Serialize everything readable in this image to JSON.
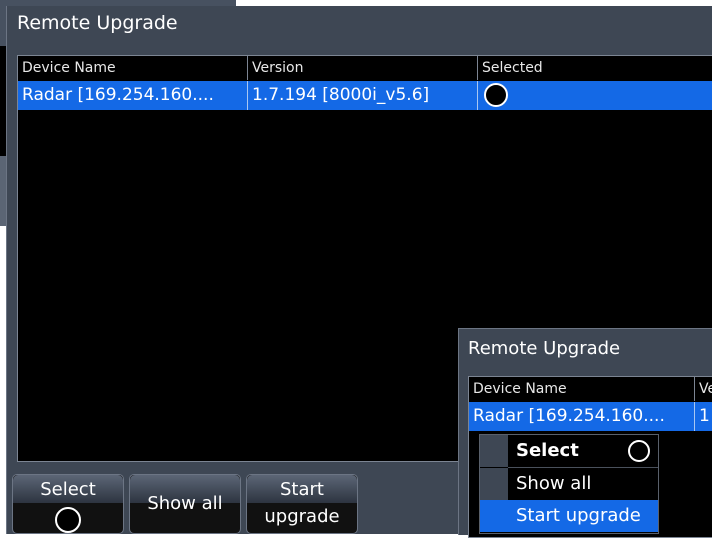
{
  "window": {
    "title": "Remote Upgrade"
  },
  "table": {
    "columns": [
      "Device Name",
      "Version",
      "Selected"
    ],
    "rows": [
      {
        "device": "Radar [169.254.160....",
        "version": "1.7.194 [8000i_v5.6]",
        "selected": true
      }
    ]
  },
  "buttons": {
    "select_label": "Select",
    "show_all_label": "Show all",
    "start_line1": "Start",
    "start_line2": "upgrade"
  },
  "popup": {
    "title": "Remote Upgrade",
    "col_device": "Device Name",
    "col_version_partial": "Ve",
    "row_device": "Radar [169.254.160....",
    "row_version_partial": "1",
    "menu": [
      {
        "label": "Select",
        "bold": true,
        "has_radio": true
      },
      {
        "label": "Show all",
        "bold": false
      },
      {
        "label": "Start upgrade",
        "highlighted": true
      }
    ]
  },
  "colors": {
    "window_bg": "#3e4754",
    "selection": "#1469e6",
    "table_bg": "#000000"
  }
}
